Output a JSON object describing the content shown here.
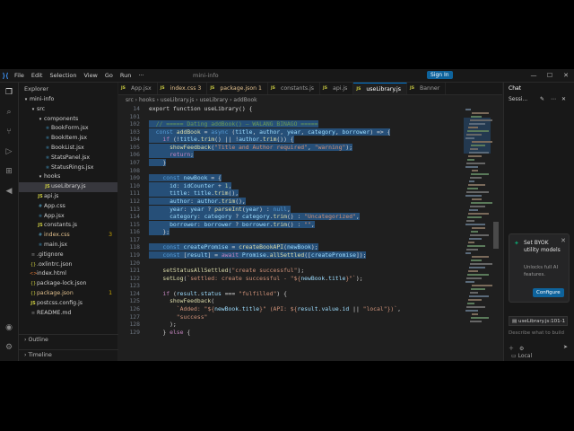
{
  "titlebar": {
    "menus": [
      "File",
      "Edit",
      "Selection",
      "View",
      "Go",
      "Run"
    ],
    "more": "···",
    "window_title": "mini-info",
    "sign_in": "Sign In"
  },
  "explorer": {
    "title": "Explorer",
    "root": "mini-info",
    "outline": "Outline",
    "timeline": "Timeline",
    "items": [
      {
        "label": "src",
        "kind": "folder",
        "indent": 1
      },
      {
        "label": "components",
        "kind": "folder",
        "indent": 2
      },
      {
        "label": "BookForm.jsx",
        "kind": "jsx",
        "indent": 3
      },
      {
        "label": "BookItem.jsx",
        "kind": "jsx",
        "indent": 3
      },
      {
        "label": "BookList.jsx",
        "kind": "jsx",
        "indent": 3
      },
      {
        "label": "StatsPanel.jsx",
        "kind": "jsx",
        "indent": 3
      },
      {
        "label": "StatusRings.jsx",
        "kind": "jsx",
        "indent": 3
      },
      {
        "label": "hooks",
        "kind": "folder",
        "indent": 2
      },
      {
        "label": "useLibrary.js",
        "kind": "js",
        "indent": 3,
        "selected": true
      },
      {
        "label": "api.js",
        "kind": "js",
        "indent": 2
      },
      {
        "label": "App.css",
        "kind": "css",
        "indent": 2
      },
      {
        "label": "App.jsx",
        "kind": "jsx",
        "indent": 2
      },
      {
        "label": "constants.js",
        "kind": "js",
        "indent": 2
      },
      {
        "label": "index.css",
        "kind": "css",
        "indent": 2,
        "count": "3"
      },
      {
        "label": "main.jsx",
        "kind": "jsx",
        "indent": 2
      },
      {
        "label": ".gitignore",
        "kind": "txt",
        "indent": 1
      },
      {
        "label": ".oxlintrc.json",
        "kind": "json",
        "indent": 1
      },
      {
        "label": "index.html",
        "kind": "html",
        "indent": 1
      },
      {
        "label": "package-lock.json",
        "kind": "json",
        "indent": 1
      },
      {
        "label": "package.json",
        "kind": "json",
        "indent": 1,
        "count": "1"
      },
      {
        "label": "postcss.config.js",
        "kind": "js",
        "indent": 1
      },
      {
        "label": "README.md",
        "kind": "txt",
        "indent": 1
      }
    ]
  },
  "tabs": [
    {
      "label": "App.jsx"
    },
    {
      "label": "index.css 3",
      "modified": true
    },
    {
      "label": "package.json 1",
      "modified": true
    },
    {
      "label": "constants.js"
    },
    {
      "label": "api.js"
    },
    {
      "label": "useLibrary.js",
      "active": true
    },
    {
      "label": "Banner"
    }
  ],
  "breadcrumbs": "src  ›  hooks  ›  useLibrary.js  ›  useLibrary  ›  addBook",
  "code": {
    "sticky": {
      "n": "14",
      "text": "export function useLibrary() {"
    },
    "lines": [
      {
        "n": "101",
        "segs": []
      },
      {
        "n": "102",
        "hl": true,
        "segs": [
          [
            "cmt",
            "  // ===== Dating addBook() — WALANG BINAGO ====="
          ]
        ]
      },
      {
        "n": "103",
        "hl": true,
        "segs": [
          [
            "kw",
            "  const "
          ],
          [
            "fn",
            "addBook"
          ],
          [
            "pun",
            " = "
          ],
          [
            "kw",
            "async "
          ],
          [
            "pun",
            "("
          ],
          [
            "var",
            "title"
          ],
          [
            "pun",
            ", "
          ],
          [
            "var",
            "author"
          ],
          [
            "pun",
            ", "
          ],
          [
            "var",
            "year"
          ],
          [
            "pun",
            ", "
          ],
          [
            "var",
            "category"
          ],
          [
            "pun",
            ", "
          ],
          [
            "var",
            "borrower"
          ],
          [
            "pun",
            ") => {"
          ]
        ]
      },
      {
        "n": "104",
        "hl": true,
        "segs": [
          [
            "ctl",
            "    if "
          ],
          [
            "pun",
            "(!"
          ],
          [
            "var",
            "title"
          ],
          [
            "pun",
            "."
          ],
          [
            "fn",
            "trim"
          ],
          [
            "pun",
            "() || !"
          ],
          [
            "var",
            "author"
          ],
          [
            "pun",
            "."
          ],
          [
            "fn",
            "trim"
          ],
          [
            "pun",
            "()) {"
          ]
        ]
      },
      {
        "n": "105",
        "hl": true,
        "segs": [
          [
            "fn",
            "      showFeedback"
          ],
          [
            "pun",
            "("
          ],
          [
            "str",
            "\"Title and Author required\""
          ],
          [
            "pun",
            ", "
          ],
          [
            "str",
            "\"warning\""
          ],
          [
            "pun",
            ");"
          ]
        ]
      },
      {
        "n": "106",
        "hl": true,
        "segs": [
          [
            "ctl",
            "      return"
          ],
          [
            "pun",
            ";"
          ]
        ]
      },
      {
        "n": "107",
        "hl": true,
        "segs": [
          [
            "pun",
            "    }"
          ]
        ]
      },
      {
        "n": "108",
        "hl": true,
        "segs": []
      },
      {
        "n": "109",
        "hl": true,
        "segs": [
          [
            "kw",
            "    const "
          ],
          [
            "var",
            "newBook"
          ],
          [
            "pun",
            " = {"
          ]
        ]
      },
      {
        "n": "110",
        "hl": true,
        "segs": [
          [
            "var",
            "      id"
          ],
          [
            "pun",
            ": "
          ],
          [
            "var",
            "idCounter"
          ],
          [
            "pun",
            " + "
          ],
          [
            "num",
            "1"
          ],
          [
            "pun",
            ","
          ]
        ]
      },
      {
        "n": "111",
        "hl": true,
        "segs": [
          [
            "var",
            "      title"
          ],
          [
            "pun",
            ": "
          ],
          [
            "var",
            "title"
          ],
          [
            "pun",
            "."
          ],
          [
            "fn",
            "trim"
          ],
          [
            "pun",
            "(),"
          ]
        ]
      },
      {
        "n": "112",
        "hl": true,
        "segs": [
          [
            "var",
            "      author"
          ],
          [
            "pun",
            ": "
          ],
          [
            "var",
            "author"
          ],
          [
            "pun",
            "."
          ],
          [
            "fn",
            "trim"
          ],
          [
            "pun",
            "(),"
          ]
        ]
      },
      {
        "n": "113",
        "hl": true,
        "segs": [
          [
            "var",
            "      year"
          ],
          [
            "pun",
            ": "
          ],
          [
            "var",
            "year"
          ],
          [
            "pun",
            " ? "
          ],
          [
            "fn",
            "parseInt"
          ],
          [
            "pun",
            "("
          ],
          [
            "var",
            "year"
          ],
          [
            "pun",
            ") : "
          ],
          [
            "kw",
            "null"
          ],
          [
            "pun",
            ","
          ]
        ]
      },
      {
        "n": "114",
        "hl": true,
        "segs": [
          [
            "var",
            "      category"
          ],
          [
            "pun",
            ": "
          ],
          [
            "var",
            "category"
          ],
          [
            "pun",
            " ? "
          ],
          [
            "var",
            "category"
          ],
          [
            "pun",
            "."
          ],
          [
            "fn",
            "trim"
          ],
          [
            "pun",
            "() : "
          ],
          [
            "str",
            "\"Uncategorized\""
          ],
          [
            "pun",
            ","
          ]
        ]
      },
      {
        "n": "115",
        "hl": true,
        "segs": [
          [
            "var",
            "      borrower"
          ],
          [
            "pun",
            ": "
          ],
          [
            "var",
            "borrower"
          ],
          [
            "pun",
            " ? "
          ],
          [
            "var",
            "borrower"
          ],
          [
            "pun",
            "."
          ],
          [
            "fn",
            "trim"
          ],
          [
            "pun",
            "() : "
          ],
          [
            "str",
            "\"\""
          ],
          [
            "pun",
            ","
          ]
        ]
      },
      {
        "n": "116",
        "hl": true,
        "segs": [
          [
            "pun",
            "    };"
          ]
        ]
      },
      {
        "n": "117",
        "hl": true,
        "segs": []
      },
      {
        "n": "118",
        "hl": true,
        "segs": [
          [
            "kw",
            "    const "
          ],
          [
            "var",
            "createPromise"
          ],
          [
            "pun",
            " = "
          ],
          [
            "fn",
            "createBookAPI"
          ],
          [
            "pun",
            "("
          ],
          [
            "var",
            "newBook"
          ],
          [
            "pun",
            ");"
          ]
        ]
      },
      {
        "n": "119",
        "hl": true,
        "segs": [
          [
            "kw",
            "    const "
          ],
          [
            "pun",
            "["
          ],
          [
            "var",
            "result"
          ],
          [
            "pun",
            "] = "
          ],
          [
            "ctl",
            "await "
          ],
          [
            "var",
            "Promise"
          ],
          [
            "pun",
            "."
          ],
          [
            "fn",
            "allSettled"
          ],
          [
            "pun",
            "(["
          ],
          [
            "var",
            "createPromise"
          ],
          [
            "pun",
            "]);"
          ]
        ]
      },
      {
        "n": "120",
        "segs": []
      },
      {
        "n": "121",
        "segs": [
          [
            "fn",
            "    setStatusAllSettled"
          ],
          [
            "pun",
            "("
          ],
          [
            "str",
            "\"create successful\""
          ],
          [
            "pun",
            ");"
          ]
        ]
      },
      {
        "n": "122",
        "segs": [
          [
            "fn",
            "    setLog"
          ],
          [
            "pun",
            "("
          ],
          [
            "str",
            "`settled: create successful - \"${"
          ],
          [
            "var",
            "newBook"
          ],
          [
            "pun",
            "."
          ],
          [
            "var",
            "title"
          ],
          [
            "str",
            "}\"`"
          ],
          [
            "pun",
            ");"
          ]
        ]
      },
      {
        "n": "123",
        "segs": []
      },
      {
        "n": "124",
        "segs": [
          [
            "ctl",
            "    if "
          ],
          [
            "pun",
            "("
          ],
          [
            "var",
            "result"
          ],
          [
            "pun",
            "."
          ],
          [
            "var",
            "status"
          ],
          [
            "pun",
            " === "
          ],
          [
            "str",
            "\"fulfilled\""
          ],
          [
            "pun",
            ") {"
          ]
        ]
      },
      {
        "n": "125",
        "segs": [
          [
            "fn",
            "      showFeedback"
          ],
          [
            "pun",
            "("
          ]
        ]
      },
      {
        "n": "126",
        "segs": [
          [
            "str",
            "        `Added: \"${"
          ],
          [
            "var",
            "newBook"
          ],
          [
            "pun",
            "."
          ],
          [
            "var",
            "title"
          ],
          [
            "str",
            "}\" (API: ${"
          ],
          [
            "var",
            "result"
          ],
          [
            "pun",
            "."
          ],
          [
            "var",
            "value"
          ],
          [
            "pun",
            "."
          ],
          [
            "var",
            "id"
          ],
          [
            "pun",
            " || "
          ],
          [
            "str",
            "\"local\""
          ],
          [
            "str",
            "})`"
          ],
          [
            "pun",
            ","
          ]
        ]
      },
      {
        "n": "127",
        "segs": [
          [
            "str",
            "        \"success\""
          ]
        ]
      },
      {
        "n": "128",
        "segs": [
          [
            "pun",
            "      );"
          ]
        ]
      },
      {
        "n": "129",
        "segs": [
          [
            "pun",
            "    } "
          ],
          [
            "ctl",
            "else "
          ],
          [
            "pun",
            "{"
          ]
        ]
      }
    ]
  },
  "chat": {
    "title": "Chat",
    "session": "Sessi...",
    "card_title": "Set BYOK utility models",
    "card_subtitle": "Unlocks full AI features.",
    "configure": "Configure",
    "context_file": "useLibrary.js:101-1",
    "input_placeholder": "Describe what to build",
    "agent": "Local"
  }
}
